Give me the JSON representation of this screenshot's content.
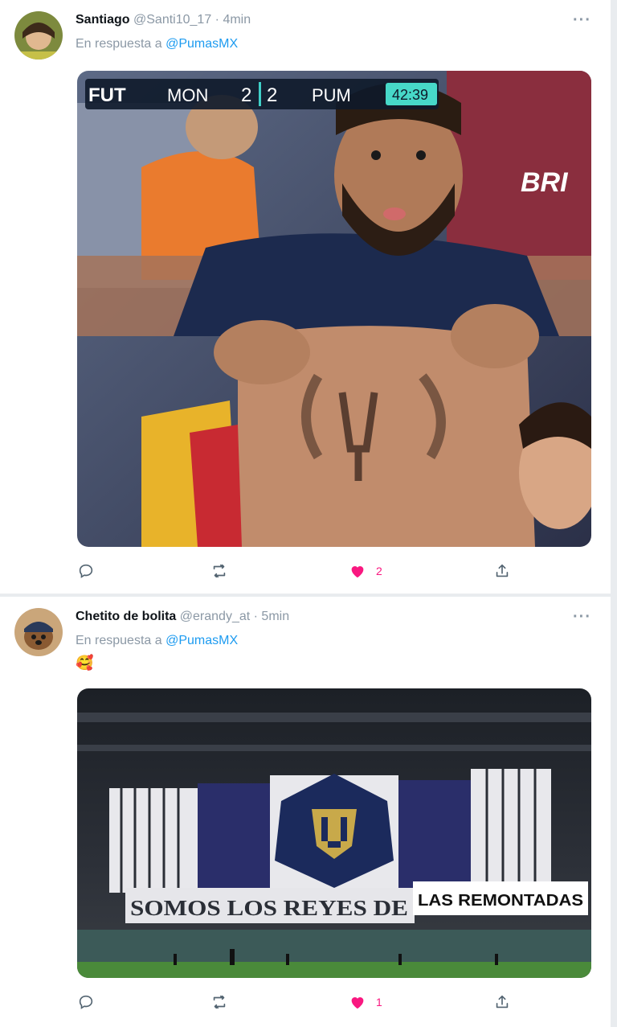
{
  "tweets": [
    {
      "author_name": "Santiago",
      "handle": "@Santi10_17",
      "separator": "·",
      "time": "4min",
      "more": "···",
      "reply_prefix": "En respuesta a",
      "reply_mention": "@PumasMX",
      "scoreboard": {
        "league": "FUT",
        "home": "MON",
        "home_score": "2",
        "away_score": "2",
        "away": "PUM",
        "clock": "42:39"
      },
      "jersey_text": "BRI",
      "actions": {
        "reply_count": "",
        "retweet_count": "",
        "like_count": "2",
        "liked": true
      }
    },
    {
      "author_name": "Chetito de bolita",
      "handle": "@erandy_at",
      "separator": "·",
      "time": "5min",
      "more": "···",
      "reply_prefix": "En respuesta a",
      "reply_mention": "@PumasMX",
      "body_emoji": "🥰",
      "banner_left": "SOMOS LOS REYES DE",
      "banner_right": "LAS REMONTADAS",
      "actions": {
        "reply_count": "",
        "retweet_count": "",
        "like_count": "1",
        "liked": true
      }
    }
  ],
  "colors": {
    "link": "#1d9bf0",
    "muted": "#8b98a5",
    "like": "#f91880",
    "pumas_blue": "#1b2a5c",
    "pumas_gold": "#c8a94a"
  }
}
